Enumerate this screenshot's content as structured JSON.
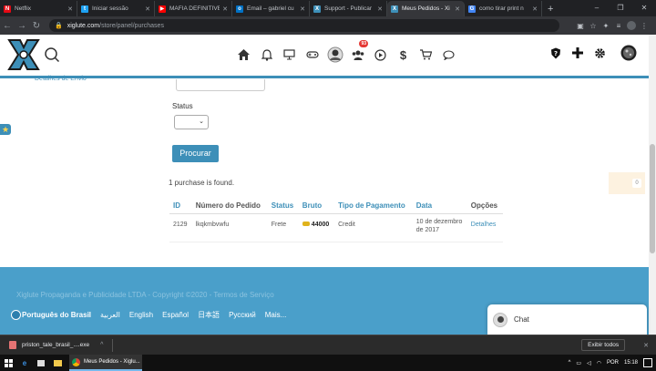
{
  "browser": {
    "tabs": [
      {
        "label": "Netflix",
        "icon": "netflix-icon",
        "color": "#e50914",
        "glyph": "N",
        "active": false
      },
      {
        "label": "Iniciar sessão",
        "icon": "twitter-icon",
        "color": "#1da1f2",
        "glyph": "t",
        "active": false
      },
      {
        "label": "MAFIA DEFINITIVE",
        "icon": "youtube-icon",
        "color": "#ff0000",
        "glyph": "▶",
        "active": false
      },
      {
        "label": "Email – gabriel cu",
        "icon": "outlook-icon",
        "color": "#0072c6",
        "glyph": "o",
        "active": false
      },
      {
        "label": "Support - Publicar",
        "icon": "xiglute-icon",
        "color": "#3d8fb8",
        "glyph": "X",
        "active": false
      },
      {
        "label": "Meus Pedidos - Xi",
        "icon": "xiglute-icon",
        "color": "#3d8fb8",
        "glyph": "X",
        "active": true
      },
      {
        "label": "como tirar print n",
        "icon": "google-icon",
        "color": "#4285f4",
        "glyph": "G",
        "active": false
      }
    ],
    "new_tab": "+",
    "url_host": "xiglute.com",
    "url_path": "/store/panel/purchases"
  },
  "header": {
    "badge_count": "93"
  },
  "sidebar": {
    "link_text": "Detalhes de Envio"
  },
  "filter": {
    "status_label": "Status",
    "search_button": "Procurar"
  },
  "results": {
    "found_text": "1 purchase is found.",
    "columns": [
      "ID",
      "Número do Pedido",
      "Status",
      "Bruto",
      "Tipo de Pagamento",
      "Data",
      "Opções"
    ],
    "rows": [
      {
        "id": "2129",
        "order_number": "lkqkmbvwfu",
        "status": "Frete",
        "gross": "44000",
        "payment_type": "Credit",
        "date": "10 de dezembro de 2017",
        "options": "Detalhes"
      }
    ]
  },
  "footer": {
    "copyright": "Xiglute Propaganda e Publicidade LTDA - Copyright ©2020  -  Termos de Serviço",
    "languages": [
      "Português do Brasil",
      "العربية",
      "English",
      "Español",
      "日本語",
      "Русский",
      "Mais..."
    ]
  },
  "chat": {
    "label": "Chat"
  },
  "downloads": {
    "file_name": "priston_tale_brasil_....exe",
    "show_all": "Exibir todos"
  },
  "taskbar": {
    "app_label": "Meus Pedidos - Xiglu...",
    "lang": "POR",
    "time": "15:18"
  },
  "colors": {
    "brand_blue": "#3d8fb8",
    "footer_blue": "#4a9fca"
  }
}
